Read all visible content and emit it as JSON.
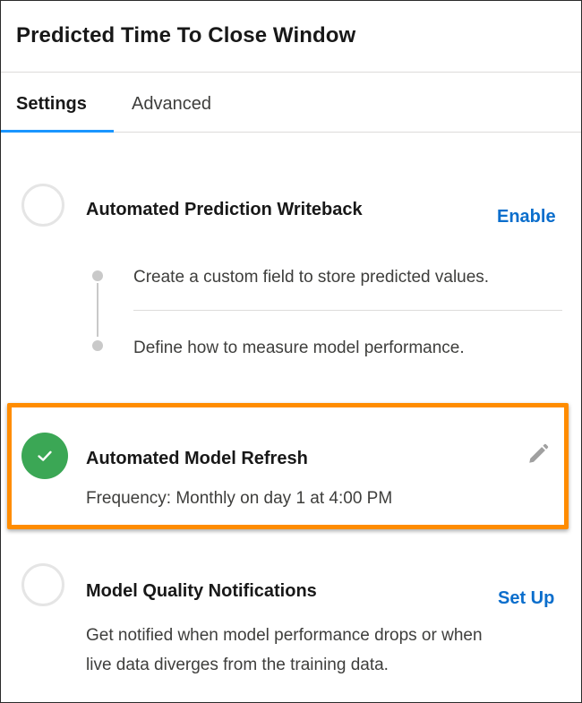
{
  "window": {
    "title": "Predicted Time To Close Window"
  },
  "tabs": [
    {
      "label": "Settings",
      "active": true
    },
    {
      "label": "Advanced",
      "active": false
    }
  ],
  "steps": {
    "writeback": {
      "title": "Automated Prediction Writeback",
      "action": "Enable",
      "substeps": [
        "Create a custom field to store predicted values.",
        "Define how to measure model performance."
      ]
    },
    "refresh": {
      "title": "Automated Model Refresh",
      "detail": "Frequency: Monthly on day 1 at 4:00 PM",
      "status_icon": "check-icon",
      "edit_icon": "pencil-icon"
    },
    "notifications": {
      "title": "Model Quality Notifications",
      "action": "Set Up",
      "description_line1": "Get notified when model performance drops or when",
      "description_line2": "live data diverges from the training data."
    }
  },
  "colors": {
    "accent": "#1b96ff",
    "link": "#0b6ecc",
    "success": "#3ba755",
    "highlight": "#ff8c00"
  }
}
